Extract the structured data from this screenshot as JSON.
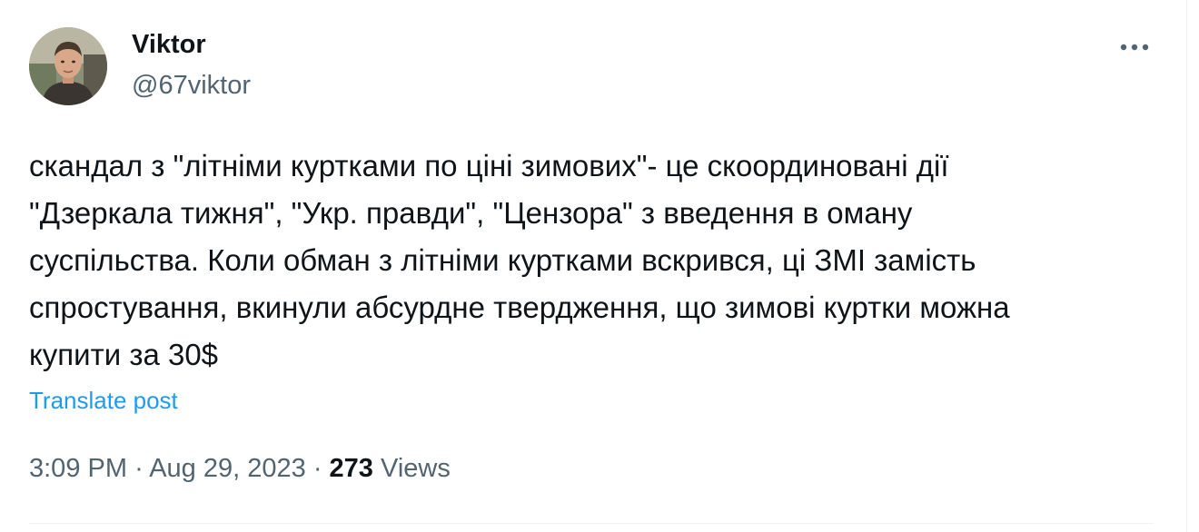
{
  "author": {
    "name": "Viktor",
    "handle": "@67viktor"
  },
  "post": {
    "text": "скандал з \"літніми куртками по ціні зимових\"- це  скоординовані дії\n\"Дзеркала тижня\", \"Укр. правди\", \"Цензора\" з введення в оману\nсуспільства. Коли обман з літніми куртками вскрився, ці ЗМІ замість\nспростування, вкинули абсурдне твердження, що зимові куртки можна\nкупити за 30$",
    "translate_label": "Translate post"
  },
  "meta": {
    "time": "3:09 PM",
    "separator": "·",
    "date": "Aug 29, 2023",
    "views_count": "273",
    "views_label": "Views"
  },
  "icons": {
    "more": "more-horizontal-icon",
    "avatar": "user-avatar"
  },
  "colors": {
    "text_primary": "#0f1419",
    "text_secondary": "#536471",
    "link": "#1d9bf0",
    "divider": "#eff3f4"
  }
}
